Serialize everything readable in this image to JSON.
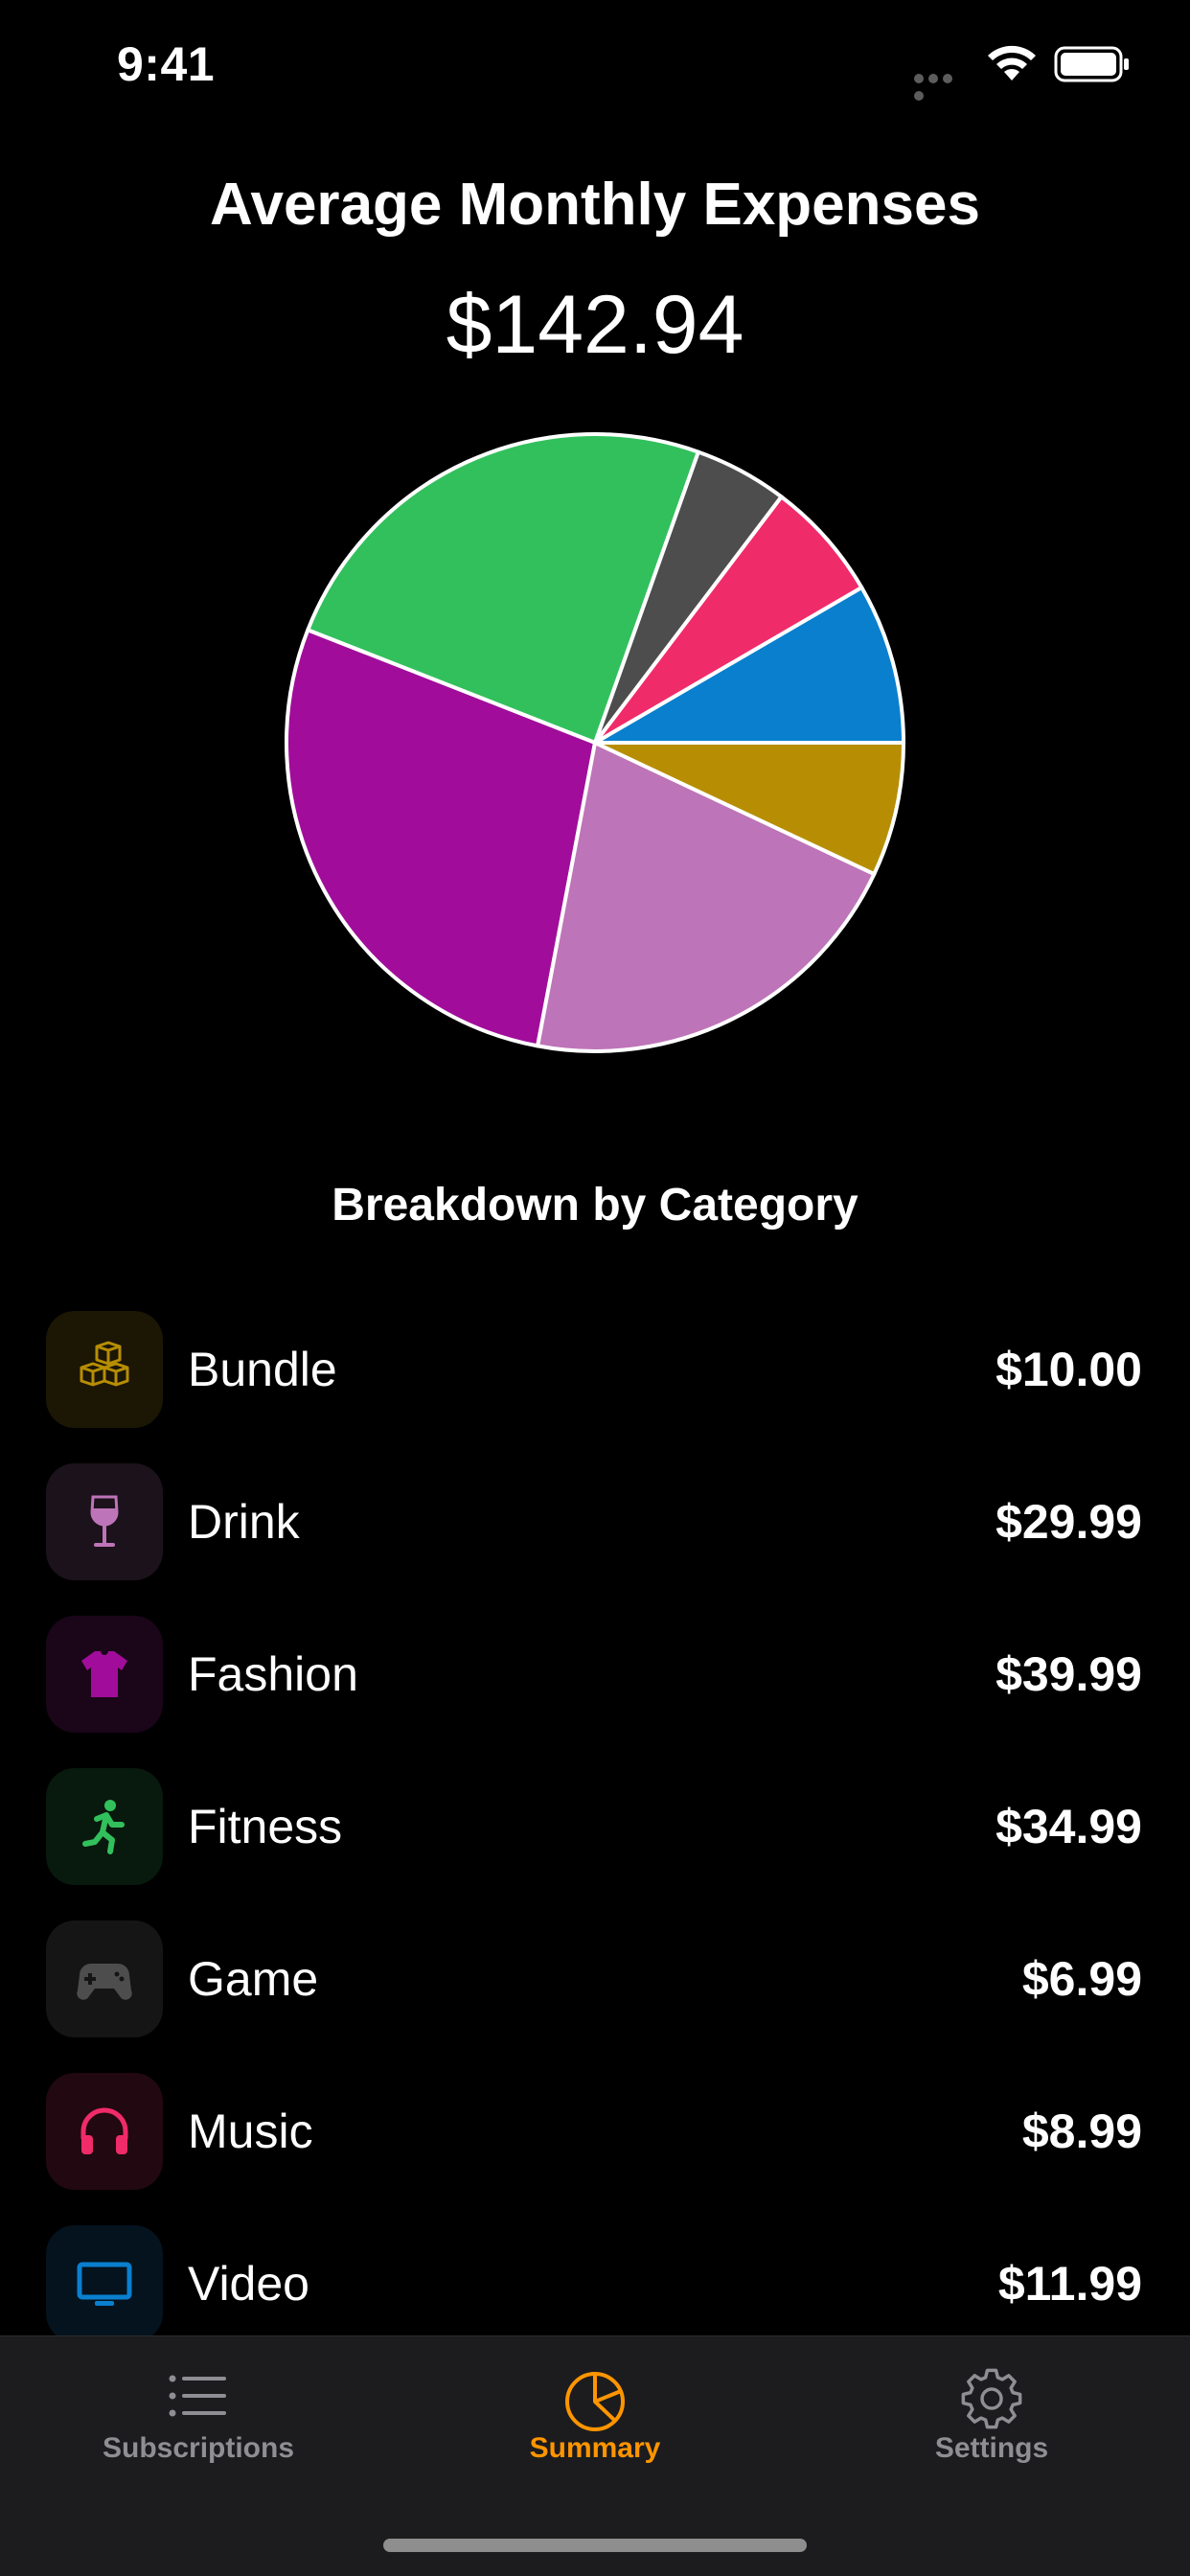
{
  "status_bar": {
    "time": "9:41"
  },
  "header": {
    "title": "Average Monthly Expenses",
    "total": "$142.94"
  },
  "section_title": "Breakdown by Category",
  "chart_data": {
    "type": "pie",
    "title": "Average Monthly Expenses",
    "categories": [
      "Video",
      "Music",
      "Game",
      "Fitness",
      "Fashion",
      "Drink",
      "Bundle"
    ],
    "values": [
      11.99,
      8.99,
      6.99,
      34.99,
      39.99,
      29.99,
      10.0
    ],
    "colors": [
      "#0a7fce",
      "#f02b6a",
      "#4d4d4d",
      "#32c05c",
      "#a10d9a",
      "#be74b8",
      "#b78e03"
    ],
    "order": "counter-clockwise from 3 o'clock",
    "slice_stroke_color": "#ffffff"
  },
  "categories": [
    {
      "name": "Bundle",
      "amount": "$10.00",
      "icon": "boxes-icon",
      "color": "#b78e03",
      "bg": "#1c1605"
    },
    {
      "name": "Drink",
      "amount": "$29.99",
      "icon": "wine-glass-icon",
      "color": "#be74b8",
      "bg": "#1c121c"
    },
    {
      "name": "Fashion",
      "amount": "$39.99",
      "icon": "tshirt-icon",
      "color": "#a10d9a",
      "bg": "#1a0519"
    },
    {
      "name": "Fitness",
      "amount": "$34.99",
      "icon": "running-figure-icon",
      "color": "#32c05c",
      "bg": "#08190d"
    },
    {
      "name": "Game",
      "amount": "$6.99",
      "icon": "gamecontroller-icon",
      "color": "#4d4d4d",
      "bg": "#151515"
    },
    {
      "name": "Music",
      "amount": "$8.99",
      "icon": "headphones-icon",
      "color": "#f02b6a",
      "bg": "#220810"
    },
    {
      "name": "Video",
      "amount": "$11.99",
      "icon": "tv-icon",
      "color": "#0a7fce",
      "bg": "#04131e"
    }
  ],
  "tab_bar": {
    "tabs": [
      {
        "label": "Subscriptions",
        "icon": "list-icon",
        "active": false
      },
      {
        "label": "Summary",
        "icon": "chart-pie-icon",
        "active": true
      },
      {
        "label": "Settings",
        "icon": "gear-icon",
        "active": false
      }
    ],
    "active_color": "#ff9500",
    "inactive_color": "#8e8e93"
  }
}
